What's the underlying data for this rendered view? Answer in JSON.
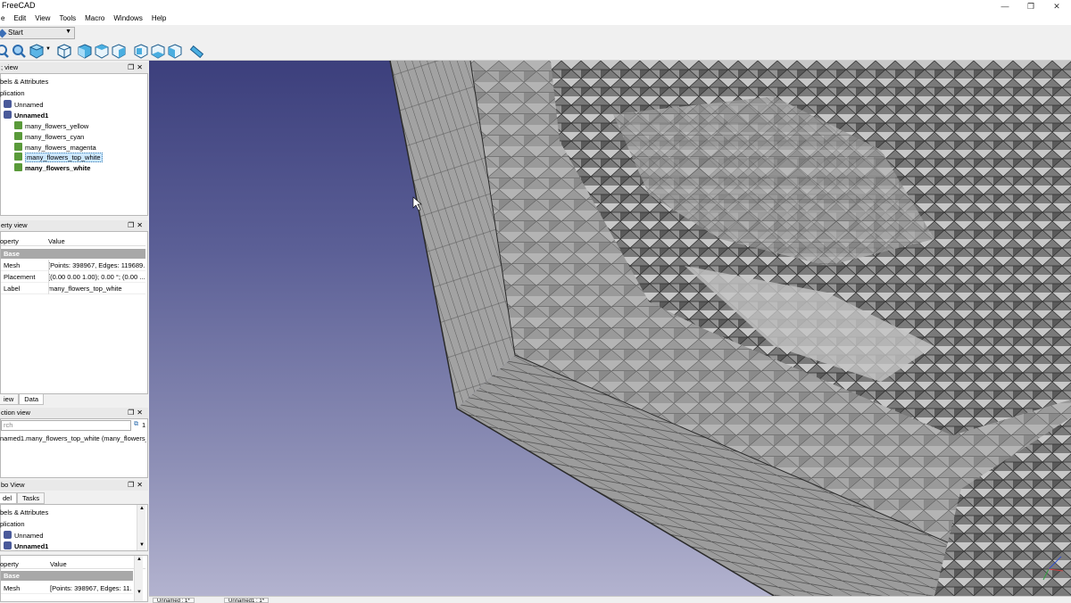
{
  "app": {
    "title": "FreeCAD"
  },
  "window_controls": {
    "minimize": "—",
    "maximize": "❐",
    "close": "✕"
  },
  "menu": [
    "e",
    "Edit",
    "View",
    "Tools",
    "Macro",
    "Windows",
    "Help"
  ],
  "workbench": {
    "selected": "Start"
  },
  "toolbar_icons": [
    "fit-all-icon",
    "fit-selection-icon",
    "draw-style-icon",
    "isometric-view-icon",
    "front-view-icon",
    "top-view-icon",
    "right-view-icon",
    "rear-view-icon",
    "bottom-view-icon",
    "left-view-icon",
    "measure-icon"
  ],
  "tree_panel": {
    "header": "; view",
    "root_label": "bels & Attributes",
    "app_label": "plication",
    "items": [
      {
        "label": "Unnamed",
        "icon": "document-icon"
      },
      {
        "label": "Unnamed1",
        "icon": "document-icon"
      },
      {
        "label": "many_flowers_yellow",
        "icon": "mesh-icon"
      },
      {
        "label": "many_flowers_cyan",
        "icon": "mesh-icon"
      },
      {
        "label": "many_flowers_magenta",
        "icon": "mesh-icon"
      },
      {
        "label": "many_flowers_top_white",
        "icon": "mesh-icon"
      },
      {
        "label": "many_flowers_white",
        "icon": "mesh-icon"
      }
    ]
  },
  "property_panel": {
    "header": "erty view",
    "col_property": "operty",
    "col_value": "Value",
    "group": "Base",
    "rows": [
      {
        "key": "Mesh",
        "value": "[Points: 398967, Edges: 119689..."
      },
      {
        "key": "Placement",
        "value": "[(0.00 0.00 1.00); 0.00 °; (0.00 ..."
      },
      {
        "key": "Label",
        "value": "many_flowers_top_white"
      }
    ],
    "tabs": [
      "iew",
      "Data"
    ]
  },
  "selection_panel": {
    "header": "ction view",
    "search_placeholder": "rch",
    "count": "1",
    "entry": "named1.many_flowers_top_white (many_flowers_"
  },
  "combo_panel": {
    "header": "bo View",
    "tabs": [
      "del",
      "Tasks"
    ],
    "root_label": "bels & Attributes",
    "app_label": "plication",
    "items": [
      {
        "label": "Unnamed"
      },
      {
        "label": "Unnamed1"
      }
    ],
    "col_property": "operty",
    "col_value": "Value",
    "group": "Base",
    "rows": [
      {
        "key": "Mesh",
        "value": "[Points: 398967, Edges: 11..."
      }
    ]
  },
  "doc_tabs": [
    "Unnamed : 1*",
    "Unnamed1 : 1*"
  ]
}
